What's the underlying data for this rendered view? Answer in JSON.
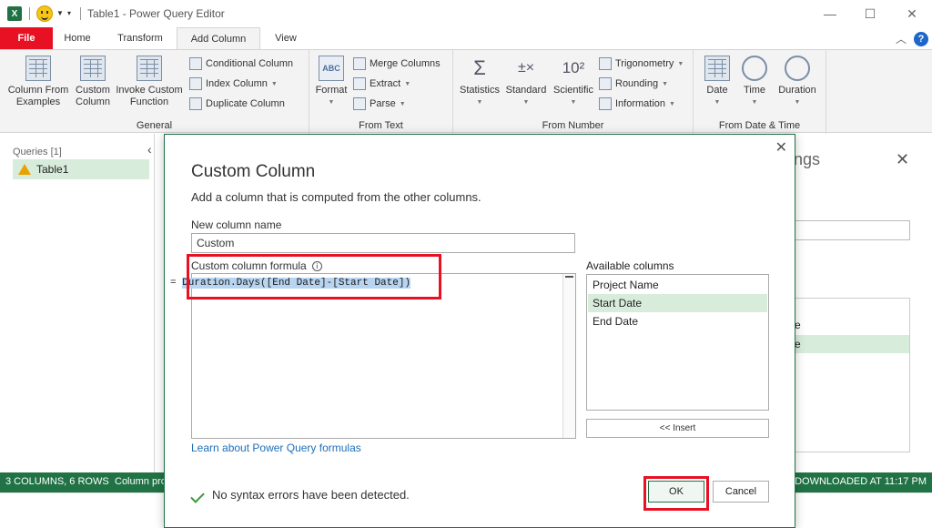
{
  "window": {
    "title": "Table1 - Power Query Editor",
    "app_badge": "X"
  },
  "tabs": [
    {
      "label": "File"
    },
    {
      "label": "Home"
    },
    {
      "label": "Transform"
    },
    {
      "label": "Add Column"
    },
    {
      "label": "View"
    }
  ],
  "active_tab": "Add Column",
  "ribbon": {
    "general": {
      "label": "General",
      "col_from_examples": "Column From Examples",
      "custom_column": "Custom Column",
      "invoke_custom_function": "Invoke Custom Function",
      "conditional_column": "Conditional Column",
      "index_column": "Index Column",
      "duplicate_column": "Duplicate Column"
    },
    "from_text": {
      "label": "From Text",
      "format": "Format",
      "merge_columns": "Merge Columns",
      "extract": "Extract",
      "parse": "Parse"
    },
    "from_number": {
      "label": "From Number",
      "statistics": "Statistics",
      "standard": "Standard",
      "scientific": "Scientific",
      "trigonometry": "Trigonometry",
      "rounding": "Rounding",
      "information": "Information"
    },
    "from_date_time": {
      "label": "From Date & Time",
      "date": "Date",
      "time": "Time",
      "duration": "Duration"
    }
  },
  "queries_pane": {
    "label": "Queries [1]",
    "items": [
      {
        "name": "Table1"
      }
    ]
  },
  "status": {
    "left": "3 COLUMNS, 6 ROWS",
    "left2": "Column pro",
    "right": "W DOWNLOADED AT 11:17 PM"
  },
  "settings_pane": {
    "title_fragment": "ngs",
    "item1": "e",
    "item2": "e"
  },
  "dialog": {
    "title": "Custom Column",
    "description": "Add a column that is computed from the other columns.",
    "new_column_label": "New column name",
    "new_column_value": "Custom",
    "formula_label": "Custom column formula",
    "formula_prefix": "= ",
    "formula": "Duration.Days([End Date]-[Start Date])",
    "available_label": "Available columns",
    "available_columns": [
      "Project Name",
      "Start Date",
      "End Date"
    ],
    "selected_column": "Start Date",
    "insert_label": "<< Insert",
    "learn_link": "Learn about Power Query formulas",
    "syntax_message": "No syntax errors have been detected.",
    "ok_label": "OK",
    "cancel_label": "Cancel"
  },
  "colors": {
    "excel_green": "#217346",
    "file_red": "#e81123",
    "highlight_red": "#e81123",
    "selection_green": "#d8ecdc",
    "formula_selection": "#b8d4f0",
    "link_blue": "#1e6fb8"
  }
}
